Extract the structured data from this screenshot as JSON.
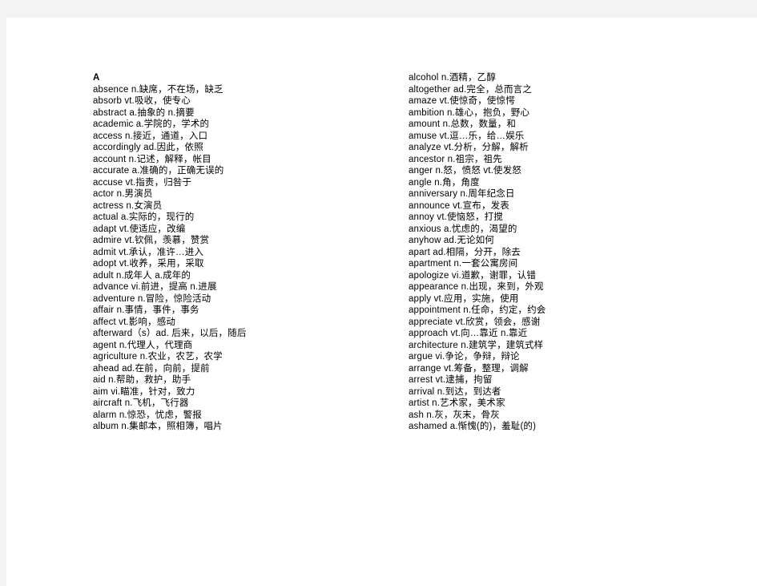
{
  "document": {
    "type": "vocabulary-list",
    "section_letter": "A",
    "page_background": "#ffffff",
    "margin_background": "#f4f4f4",
    "text_color": "#000000"
  },
  "columns": [
    {
      "name": "left-column",
      "heading": "A",
      "entries": [
        "absence n.缺席，不在场，缺乏",
        "absorb vt.吸收，使专心",
        "abstract a.抽象的 n.摘要",
        "academic a.学院的，学术的",
        "access n.接近，通道，入口",
        "accordingly ad.因此，依照",
        "account n.记述，解释，帐目",
        "accurate a.准确的，正确无误的",
        "accuse vt.指责，归咎于",
        "actor n.男演员",
        "actress n.女演员",
        "actual a.实际的，现行的",
        "adapt vt.使适应，改编",
        "admire vt.钦佩，羡慕，赞赏",
        "admit vt.承认，准许…进入",
        "adopt vt.收养，采用，采取",
        "adult n.成年人 a.成年的",
        "advance vi.前进，提高 n.进展",
        "adventure n.冒险，惊险活动",
        "affair n.事情，事件，事务",
        "affect vt.影响，感动",
        "afterward（s）ad. 后来，以后，随后",
        "agent n.代理人，代理商",
        "agriculture n.农业，农艺，农学",
        "ahead ad.在前，向前，提前",
        "aid n.帮助，救护，助手",
        "aim vi.瞄准，针对，致力",
        "aircraft n.飞机，飞行器",
        "alarm n.惊恐，忧虑，警报",
        "album n.集邮本，照相簿，唱片"
      ]
    },
    {
      "name": "right-column",
      "heading": "",
      "entries": [
        "alcohol n.酒精，乙醇",
        "altogether ad.完全，总而言之",
        "amaze vt.使惊奇，使惊愕",
        "ambition n.雄心，抱负，野心",
        "amount n.总数，数量，和",
        "amuse vt.逗…乐，给…娱乐",
        "analyze vt.分析，分解，解析",
        "ancestor n.祖宗，祖先",
        "anger n.怒，愤怒 vt.使发怒",
        "angle n.角，角度",
        "anniversary n.周年纪念日",
        "announce vt.宣布，发表",
        "annoy vt.使恼怒，打搅",
        "anxious a.忧虑的，渴望的",
        "anyhow ad.无论如何",
        "apart ad.相隔，分开，除去",
        "apartment n.一套公寓房间",
        "apologize vi.道歉，谢罪，认错",
        "appearance n.出现，来到，外观",
        "apply vt.应用，实施，使用",
        "appointment n.任命，约定，约会",
        "appreciate vt.欣赏，领会，感谢",
        "approach vt.向…靠近 n.靠近",
        "architecture n.建筑学，建筑式样",
        "argue vi.争论，争辩，辩论",
        "arrange vt.筹备，整理，调解",
        "arrest vt.逮捕，拘留",
        "arrival n.到达，到达者",
        "artist n.艺术家，美术家",
        "ash n.灰，灰末，骨灰",
        "ashamed a.惭愧(的)，羞耻(的)"
      ]
    }
  ]
}
